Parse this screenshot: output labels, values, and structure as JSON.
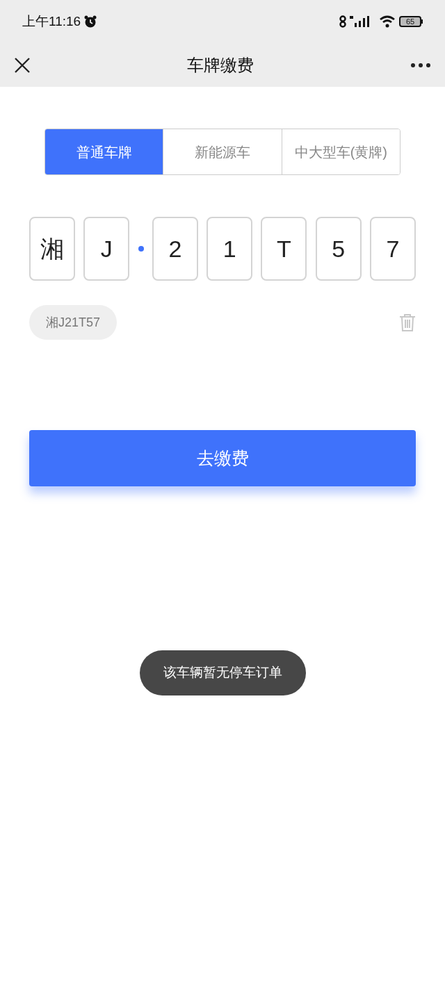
{
  "status_bar": {
    "time": "上午11:16",
    "battery": "65"
  },
  "nav": {
    "title": "车牌缴费"
  },
  "tabs": [
    {
      "label": "普通车牌",
      "selected": true
    },
    {
      "label": "新能源车",
      "selected": false
    },
    {
      "label": "中大型车(黄牌)",
      "selected": false
    }
  ],
  "plate": [
    {
      "kind": "char",
      "text": "湘"
    },
    {
      "kind": "char",
      "text": "J"
    },
    {
      "kind": "separator"
    },
    {
      "kind": "char",
      "text": "2"
    },
    {
      "kind": "char",
      "text": "1"
    },
    {
      "kind": "char",
      "text": "T"
    },
    {
      "kind": "char",
      "text": "5"
    },
    {
      "kind": "char",
      "text": "7"
    }
  ],
  "history": [
    {
      "text": "湘J21T57"
    }
  ],
  "pay_button": "去缴费",
  "toast": "该车辆暂无停车订单"
}
